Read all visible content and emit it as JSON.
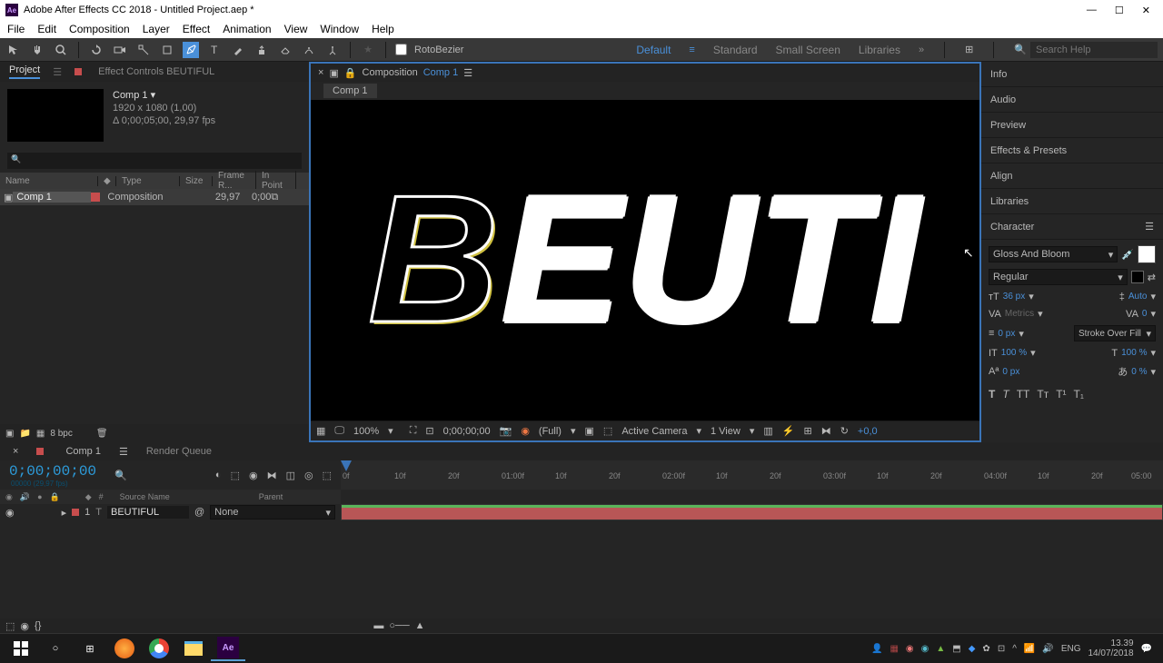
{
  "title": "Adobe After Effects CC 2018 - Untitled Project.aep *",
  "menus": [
    "File",
    "Edit",
    "Composition",
    "Layer",
    "Effect",
    "Animation",
    "View",
    "Window",
    "Help"
  ],
  "toolbar": {
    "rotobezier_label": "RotoBezier"
  },
  "workspaces": [
    "Default",
    "Standard",
    "Small Screen",
    "Libraries"
  ],
  "search_placeholder": "Search Help",
  "project": {
    "tabs": {
      "project": "Project",
      "fx": "Effect Controls BEUTIFUL"
    },
    "comp_name": "Comp 1 ▾",
    "comp_dims": "1920 x 1080 (1,00)",
    "comp_dur": "Δ 0;00;05;00, 29,97 fps",
    "cols": {
      "name": "Name",
      "type": "Type",
      "size": "Size",
      "fr": "Frame R...",
      "in": "In Point"
    },
    "rows": [
      {
        "name": "Comp 1",
        "type": "Composition",
        "fr": "29,97",
        "in": "0;00"
      }
    ],
    "bpc": "8 bpc"
  },
  "comp_panel": {
    "prefix": "Composition",
    "name": "Comp 1",
    "tab": "Comp 1",
    "big_text_sel": "B",
    "big_text_rest": "EUTI"
  },
  "viewer_ctrl": {
    "zoom": "100%",
    "time": "0;00;00;00",
    "res": "(Full)",
    "camera": "Active Camera",
    "view": "1 View",
    "exp": "+0,0"
  },
  "right_panels": [
    "Info",
    "Audio",
    "Preview",
    "Effects & Presets",
    "Align",
    "Libraries",
    "Character"
  ],
  "char": {
    "font": "Gloss And Bloom",
    "style": "Regular",
    "size": "36 px",
    "leading": "Auto",
    "kern": "Metrics",
    "track": "0",
    "stroke_w": "0 px",
    "stroke_mode": "Stroke Over Fill",
    "vscale": "100 %",
    "hscale": "100 %",
    "baseline": "0 px",
    "tsume": "0 %"
  },
  "timeline": {
    "tabs": {
      "comp": "Comp 1",
      "rq": "Render Queue"
    },
    "timecode": "0;00;00;00",
    "sub": "00000 (29,97 fps)",
    "ruler": [
      "0f",
      "10f",
      "20f",
      "01:00f",
      "10f",
      "20f",
      "02:00f",
      "10f",
      "20f",
      "03:00f",
      "10f",
      "20f",
      "04:00f",
      "10f",
      "20f",
      "05:00"
    ],
    "layer_cols": {
      "num": "#",
      "src": "Source Name",
      "parent": "Parent"
    },
    "layers": [
      {
        "num": "1",
        "name": "BEUTIFUL",
        "parent": "None"
      }
    ]
  },
  "taskbar": {
    "lang": "ENG",
    "time": "13.39",
    "date": "14/07/2018"
  }
}
